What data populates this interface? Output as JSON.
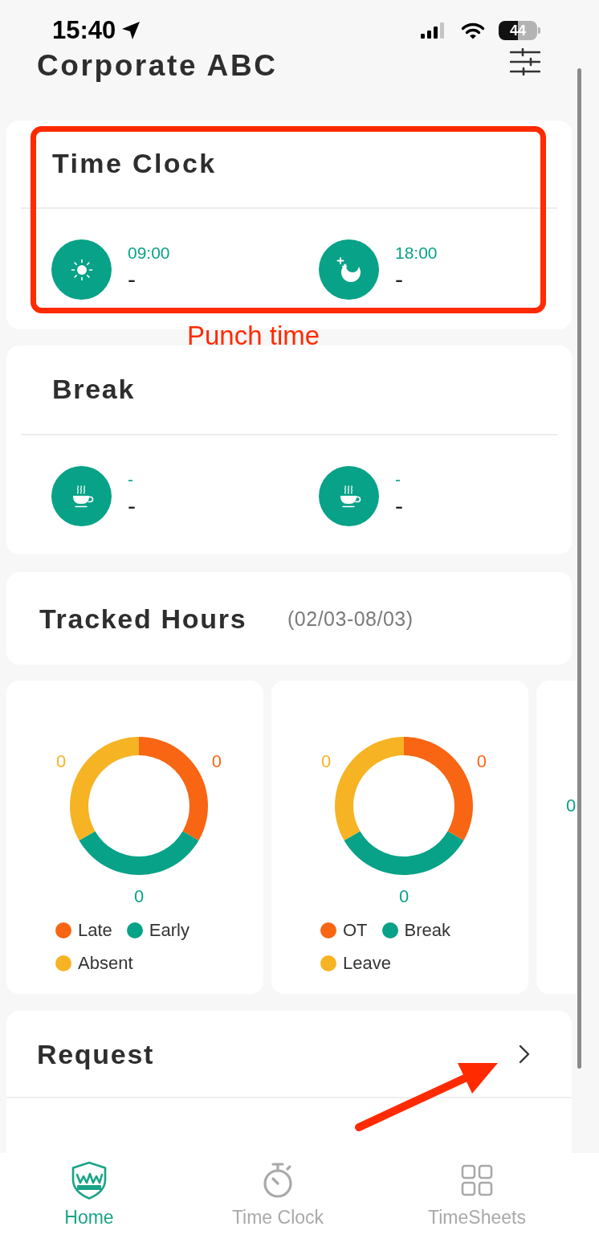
{
  "status_bar": {
    "time": "15:40",
    "battery": "44"
  },
  "header": {
    "title": "Corporate ABC"
  },
  "time_clock": {
    "title": "Time Clock",
    "entries": [
      {
        "time": "09:00",
        "value": "-"
      },
      {
        "time": "18:00",
        "value": "-"
      }
    ]
  },
  "annotation": {
    "label": "Punch time"
  },
  "break": {
    "title": "Break",
    "entries": [
      {
        "time": "-",
        "value": "-"
      },
      {
        "time": "-",
        "value": "-"
      }
    ]
  },
  "tracked_hours": {
    "title": "Tracked Hours",
    "period": "(02/03-08/03)"
  },
  "chart_cards": [
    {
      "kind": "donut",
      "slices": [
        {
          "label": "Late",
          "value": "0",
          "color": "#f86513"
        },
        {
          "label": "Early",
          "value": "0",
          "color": "#07a287"
        },
        {
          "label": "Absent",
          "value": "0",
          "color": "#f6b324"
        }
      ]
    },
    {
      "kind": "donut",
      "slices": [
        {
          "label": "OT",
          "value": "0",
          "color": "#f86513"
        },
        {
          "label": "Break",
          "value": "0",
          "color": "#07a287"
        },
        {
          "label": "Leave",
          "value": "0",
          "color": "#f6b324"
        }
      ]
    },
    {
      "kind": "cut_off",
      "label": "0"
    }
  ],
  "request": {
    "title": "Request"
  },
  "bottom_nav": [
    {
      "label": "Home",
      "selected": true
    },
    {
      "label": "Time Clock",
      "selected": false
    },
    {
      "label": "TimeSheets",
      "selected": false
    }
  ]
}
